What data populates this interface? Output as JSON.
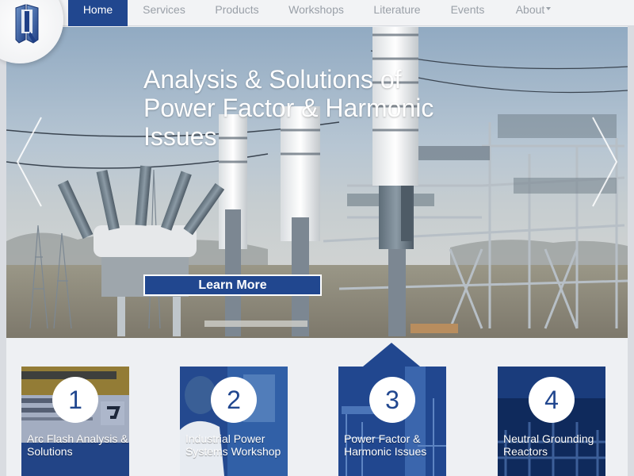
{
  "nav": {
    "items": [
      {
        "label": "Home",
        "active": true
      },
      {
        "label": "Services"
      },
      {
        "label": "Products"
      },
      {
        "label": "Workshops"
      },
      {
        "label": "Literature"
      },
      {
        "label": "Events"
      },
      {
        "label": "About"
      }
    ]
  },
  "hero": {
    "title": "Analysis & Solutions of Power Factor & Harmonic Issues",
    "button_label": "Learn More"
  },
  "cards": [
    {
      "number": "1",
      "label": "Arc Flash Analysis & Solutions"
    },
    {
      "number": "2",
      "label": "Industrial Power Systems Workshop"
    },
    {
      "number": "3",
      "label": "Power Factor & Harmonic Issues"
    },
    {
      "number": "4",
      "label": "Neutral Grounding Reactors"
    }
  ],
  "colors": {
    "accent": "#21478f",
    "nav_bg": "#f2f3f5",
    "nav_text": "#9aa0a8",
    "page_bg": "#eef0f3"
  },
  "icons": [
    "logo-icon",
    "chevron-left-icon",
    "chevron-right-icon",
    "caret-down-icon"
  ]
}
